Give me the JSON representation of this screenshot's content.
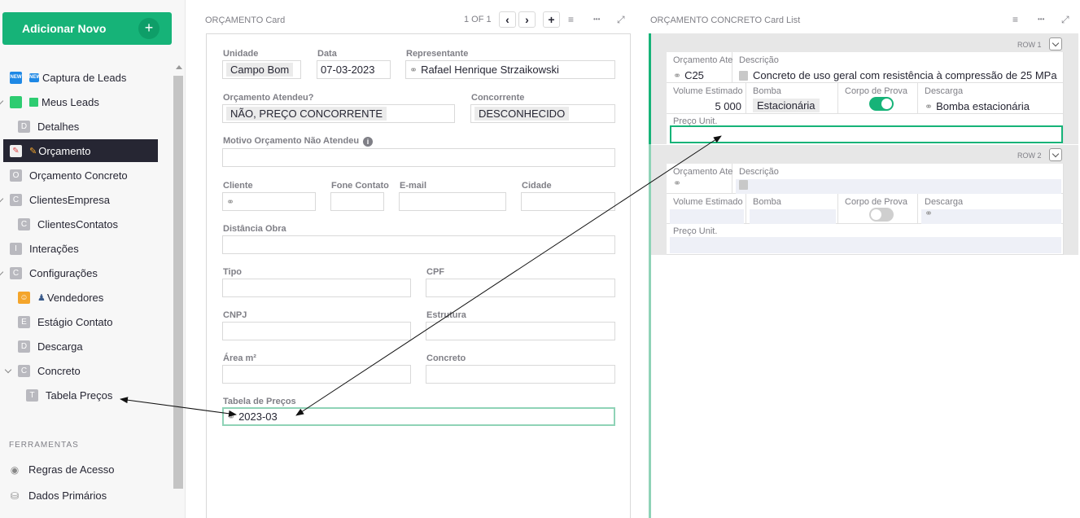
{
  "sidebar": {
    "add_button": "Adicionar Novo",
    "add_plus": "+",
    "items": [
      {
        "label": "Captura de Leads",
        "badge": "NEW",
        "prefix_badge": "NEW"
      },
      {
        "label": "Meus Leads",
        "badge": "",
        "prefix_square": "#2ecc71"
      },
      {
        "label": "Detalhes",
        "badge": "D"
      },
      {
        "label": "Orçamento",
        "badge": "📝",
        "prefix_emoji": "📝"
      },
      {
        "label": "Orçamento Concreto",
        "badge": "O"
      },
      {
        "label": "ClientesEmpresa",
        "badge": "C"
      },
      {
        "label": "ClientesContatos",
        "badge": "C"
      },
      {
        "label": "Interações",
        "badge": "I"
      },
      {
        "label": "Configurações",
        "badge": "C"
      },
      {
        "label": "Vendedores",
        "badge": "👨",
        "prefix_emoji": "👨‍💼"
      },
      {
        "label": "Estágio Contato",
        "badge": "E"
      },
      {
        "label": "Descarga",
        "badge": "D"
      },
      {
        "label": "Concreto",
        "badge": "C"
      },
      {
        "label": "Tabela Preços",
        "badge": "T"
      }
    ],
    "tools_title": "FERRAMENTAS",
    "tools": [
      {
        "label": "Regras de Acesso",
        "icon": "eye-icon"
      },
      {
        "label": "Dados Primários",
        "icon": "database-icon"
      }
    ]
  },
  "card": {
    "title": "ORÇAMENTO Card",
    "pager": "1 OF 1",
    "fields": {
      "unidade": {
        "label": "Unidade",
        "value": "Campo Bom"
      },
      "data": {
        "label": "Data",
        "value": "07-03-2023"
      },
      "representante": {
        "label": "Representante",
        "value": "Rafael Henrique Strzaikowski"
      },
      "orcamento_atendeu": {
        "label": "Orçamento Atendeu?",
        "value": "NÃO, PREÇO CONCORRENTE"
      },
      "concorrente": {
        "label": "Concorrente",
        "value": "DESCONHECIDO"
      },
      "motivo": {
        "label": "Motivo Orçamento Não Atendeu",
        "info": "i"
      },
      "cliente": {
        "label": "Cliente"
      },
      "fone": {
        "label": "Fone Contato"
      },
      "email": {
        "label": "E-mail"
      },
      "cidade": {
        "label": "Cidade"
      },
      "distancia": {
        "label": "Distância Obra"
      },
      "tipo": {
        "label": "Tipo"
      },
      "cpf": {
        "label": "CPF"
      },
      "cnpj": {
        "label": "CNPJ"
      },
      "estrutura": {
        "label": "Estrutura"
      },
      "area": {
        "label": "Área m²"
      },
      "concreto": {
        "label": "Concreto"
      },
      "tabela": {
        "label": "Tabela de Preços",
        "value": "2023-03"
      }
    }
  },
  "list": {
    "title": "ORÇAMENTO CONCRETO Card List",
    "rows": [
      {
        "row_label": "ROW 1",
        "orcamento_label": "Orçamento Ate",
        "orcamento_value": "C25",
        "descricao_label": "Descrição",
        "descricao_value": "Concreto de uso geral com resistência à compressão de 25 MPa",
        "volume_label": "Volume Estimado",
        "volume_value": "5 000",
        "bomba_label": "Bomba",
        "bomba_value": "Estacionária",
        "corpo_label": "Corpo de Prova",
        "corpo_on": true,
        "descarga_label": "Descarga",
        "descarga_value": "Bomba estacionária",
        "preco_label": "Preço Unit."
      },
      {
        "row_label": "ROW 2",
        "orcamento_label": "Orçamento Ate",
        "descricao_label": "Descrição",
        "volume_label": "Volume Estimado",
        "bomba_label": "Bomba",
        "corpo_label": "Corpo de Prova",
        "corpo_on": false,
        "descarga_label": "Descarga",
        "preco_label": "Preço Unit."
      }
    ]
  },
  "icons": {
    "prev": "‹",
    "next": "›",
    "add": "+",
    "filter": "≡",
    "more": "•••",
    "expand": "⤢",
    "link": "🔗"
  },
  "colors": {
    "accent": "#16b378",
    "active_nav": "#262633",
    "highlight": "#8fd3b7"
  }
}
